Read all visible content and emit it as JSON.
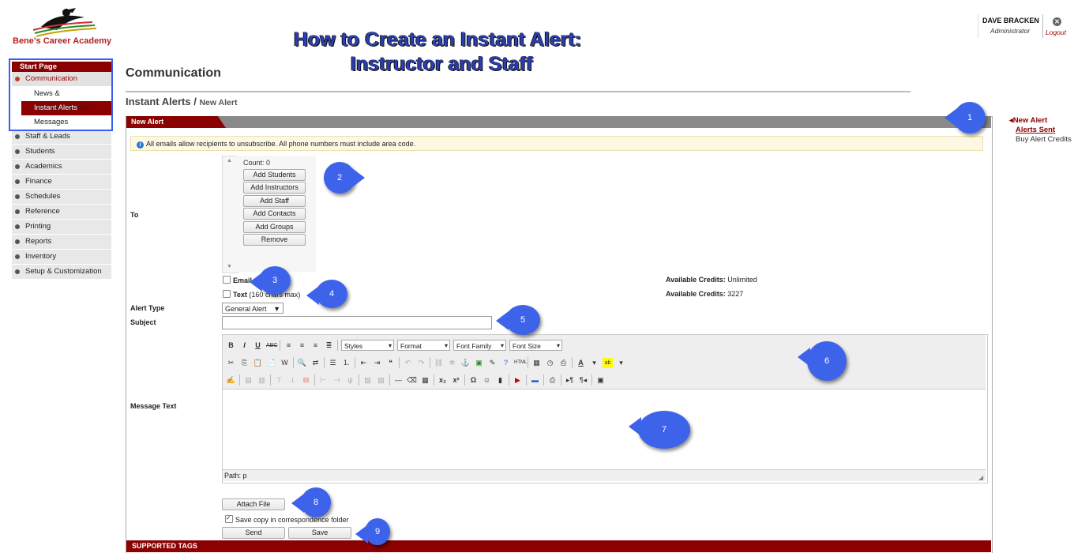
{
  "app": {
    "logo_text": "Bene's Career Academy",
    "user_name": "DAVE BRACKEN",
    "user_role": "Administrator",
    "logout": "Logout"
  },
  "tutorial": {
    "title_line1": "How to Create an Instant Alert:",
    "title_line2": "Instructor and Staff"
  },
  "sidebar": {
    "header": "Start Page",
    "active_section": "Communication",
    "subitems": [
      "News & Announcements",
      "Instant Alerts",
      "Messages"
    ],
    "items": [
      "Staff & Leads",
      "Students",
      "Academics",
      "Finance",
      "Schedules",
      "Reference",
      "Printing",
      "Reports",
      "Inventory",
      "Setup & Customization"
    ]
  },
  "page": {
    "title": "Communication",
    "breadcrumb_main": "Instant Alerts",
    "breadcrumb_sep": " / ",
    "breadcrumb_sub": "New Alert",
    "panel_tab": "New Alert",
    "info": "All emails allow recipients to unsubscribe. All phone numbers must include area code."
  },
  "form": {
    "to_label": "To",
    "count": "Count: 0",
    "buttons": [
      "Add Students",
      "Add Instructors",
      "Add Staff",
      "Add Contacts",
      "Add Groups",
      "Remove"
    ],
    "email_label": "Email",
    "text_label": "Text",
    "text_note": "(160 chars max)",
    "credits_label": "Available Credits:",
    "email_credits": "Unlimited",
    "text_credits": "3227",
    "alert_type_label": "Alert Type",
    "alert_type_value": "General Alert",
    "subject_label": "Subject",
    "subject_value": "",
    "message_label": "Message Text",
    "editor_styles": "Styles",
    "editor_format": "Format",
    "editor_font_family": "Font Family",
    "editor_font_size": "Font Size",
    "path": "Path: p",
    "attach_button": "Attach File",
    "save_copy_label": "Save copy in correspondence folder",
    "send_button": "Send",
    "save_button": "Save",
    "supported_tags": "SUPPORTED TAGS"
  },
  "right_nav": {
    "new_alert": "New Alert",
    "alerts_sent": "Alerts Sent",
    "buy_credits": "Buy Alert Credits"
  },
  "callouts": [
    "1",
    "2",
    "3",
    "4",
    "5",
    "6",
    "7",
    "8",
    "9"
  ],
  "colors": {
    "brand": "#8b0000",
    "callout": "#3d63ea",
    "title_blue": "#2c3fb0"
  }
}
